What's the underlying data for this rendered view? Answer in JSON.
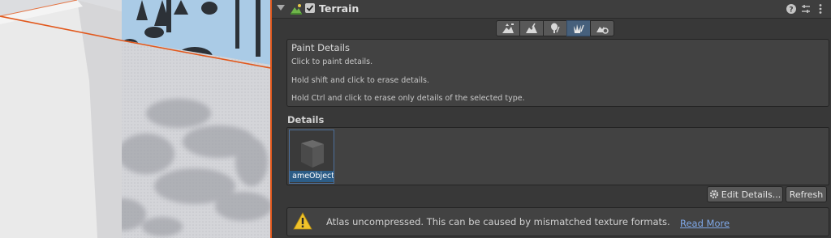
{
  "scene": {
    "accent_color": "#e2581c",
    "sky_color": "#aacbe6",
    "ground_color": "#c9cace"
  },
  "inspector": {
    "component": {
      "title": "Terrain",
      "enabled": true,
      "icon": "terrain-icon",
      "header_buttons": [
        "help-icon",
        "preset-icon",
        "kebab-menu-icon"
      ]
    },
    "toolbar": {
      "tools": [
        {
          "name": "raise-lower-terrain-tool",
          "icon": "raise-terrain-icon",
          "active": false
        },
        {
          "name": "paint-terrain-tool",
          "icon": "paint-terrain-icon",
          "active": false
        },
        {
          "name": "paint-trees-tool",
          "icon": "tree-icon",
          "active": false
        },
        {
          "name": "paint-details-tool",
          "icon": "grass-icon",
          "active": true
        },
        {
          "name": "terrain-settings-tool",
          "icon": "terrain-settings-icon",
          "active": false
        }
      ],
      "active_color": "#46607c"
    },
    "help": {
      "title": "Paint Details",
      "lines": [
        "Click to paint details.",
        "Hold shift and click to erase details.",
        "Hold Ctrl and click to erase only details of the selected type."
      ]
    },
    "details": {
      "label": "Details",
      "items": [
        {
          "name": "ameObject (",
          "icon": "cube-icon",
          "selected": true
        }
      ],
      "edit_button": "Edit Details...",
      "refresh_button": "Refresh"
    },
    "warning": {
      "icon": "warning-icon",
      "text": "Atlas uncompressed. This can be caused by mismatched texture formats.",
      "link": "Read More",
      "link_color": "#7fa8e8"
    }
  }
}
